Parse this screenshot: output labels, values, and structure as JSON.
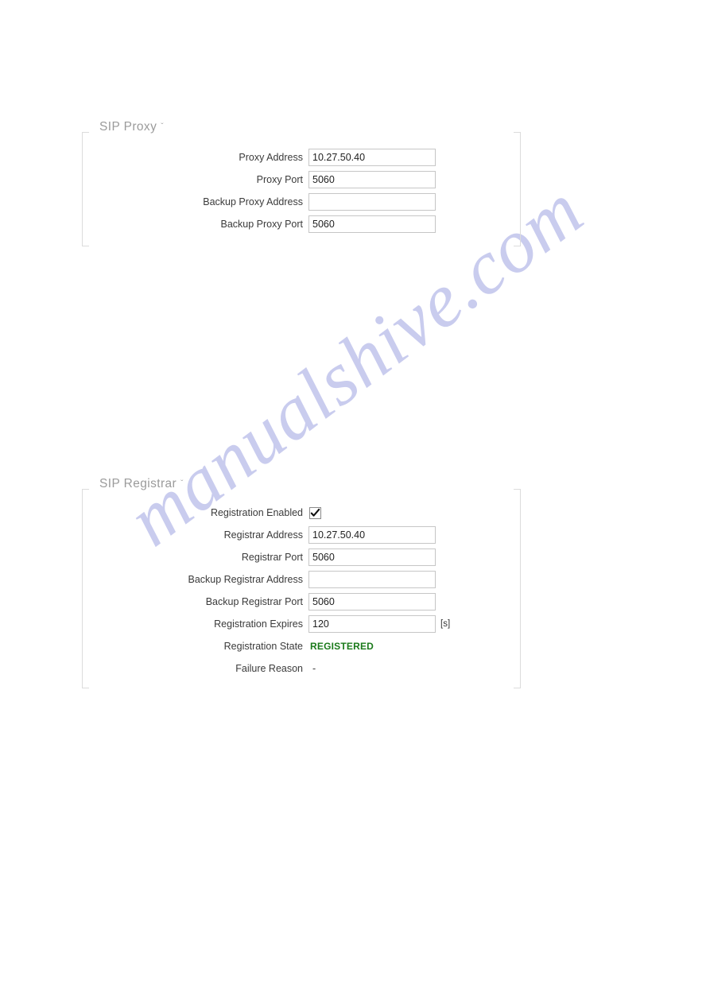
{
  "watermark": {
    "text": "manualshive.com",
    "color": "#c7caee"
  },
  "colors": {
    "frame_border": "#dcdcdc",
    "label_text": "#3a3a3a",
    "title_text": "#9b9b9b",
    "input_border": "#c6c6c6",
    "state_registered": "#1a7a1a"
  },
  "sections": [
    {
      "title": "SIP Proxy",
      "chevron": "ˇ",
      "rows": [
        {
          "label": "Proxy Address",
          "type": "text",
          "value": "10.27.50.40",
          "unit": ""
        },
        {
          "label": "Proxy Port",
          "type": "text",
          "value": "5060",
          "unit": ""
        },
        {
          "label": "Backup Proxy Address",
          "type": "text",
          "value": "",
          "unit": ""
        },
        {
          "label": "Backup Proxy Port",
          "type": "text",
          "value": "5060",
          "unit": ""
        }
      ]
    },
    {
      "title": "SIP Registrar",
      "chevron": "ˇ",
      "rows": [
        {
          "label": "Registration Enabled",
          "type": "checkbox",
          "value": "checked",
          "unit": ""
        },
        {
          "label": "Registrar Address",
          "type": "text",
          "value": "10.27.50.40",
          "unit": ""
        },
        {
          "label": "Registrar Port",
          "type": "text",
          "value": "5060",
          "unit": ""
        },
        {
          "label": "Backup Registrar Address",
          "type": "text",
          "value": "",
          "unit": ""
        },
        {
          "label": "Backup Registrar Port",
          "type": "text",
          "value": "5060",
          "unit": ""
        },
        {
          "label": "Registration Expires",
          "type": "text",
          "value": "120",
          "unit": "[s]"
        },
        {
          "label": "Registration State",
          "type": "status",
          "value": "REGISTERED",
          "unit": ""
        },
        {
          "label": "Failure Reason",
          "type": "static",
          "value": "-",
          "unit": ""
        }
      ]
    }
  ]
}
